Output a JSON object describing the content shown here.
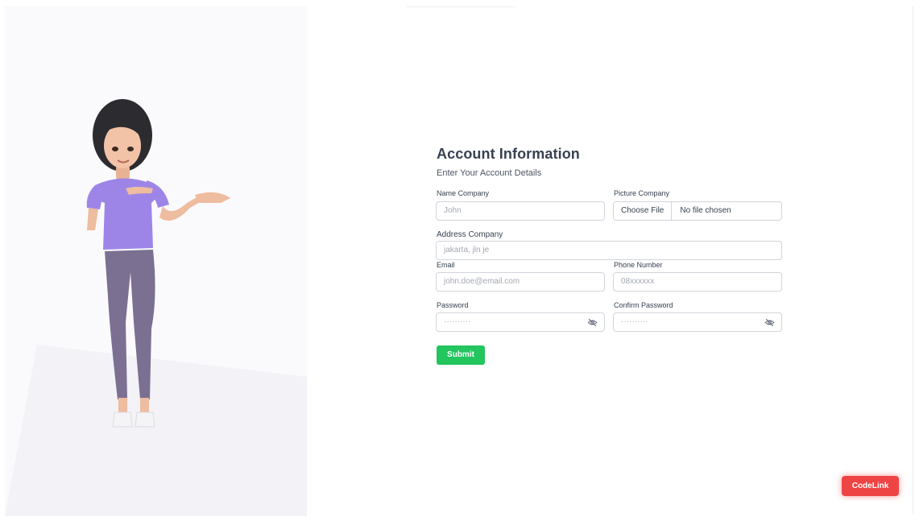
{
  "form": {
    "title": "Account Information",
    "subtitle": "Enter Your Account Details",
    "fields": {
      "name_company": {
        "label": "Name Company",
        "placeholder": "John"
      },
      "picture_company": {
        "label": "Picture Company",
        "button": "Choose File",
        "status": "No file chosen"
      },
      "address_company": {
        "label": "Address Company",
        "placeholder": "jakarta, jln je"
      },
      "email": {
        "label": "Email",
        "placeholder": "john.doe@email.com"
      },
      "phone": {
        "label": "Phone Number",
        "placeholder": "08xxxxxx"
      },
      "password": {
        "label": "Password",
        "placeholder": "··········"
      },
      "confirm_password": {
        "label": "Confirm Password",
        "placeholder": "··········"
      }
    },
    "submit_label": "Submit"
  },
  "floating": {
    "codelink_label": "CodeLink"
  },
  "colors": {
    "accent_green": "#22c55e",
    "accent_red": "#ef4444",
    "panel_bg": "#fafafc",
    "character_shirt": "#9d85e8",
    "character_pants": "#7b6f92"
  },
  "icons": {
    "password_toggle": "eye-off-icon"
  }
}
